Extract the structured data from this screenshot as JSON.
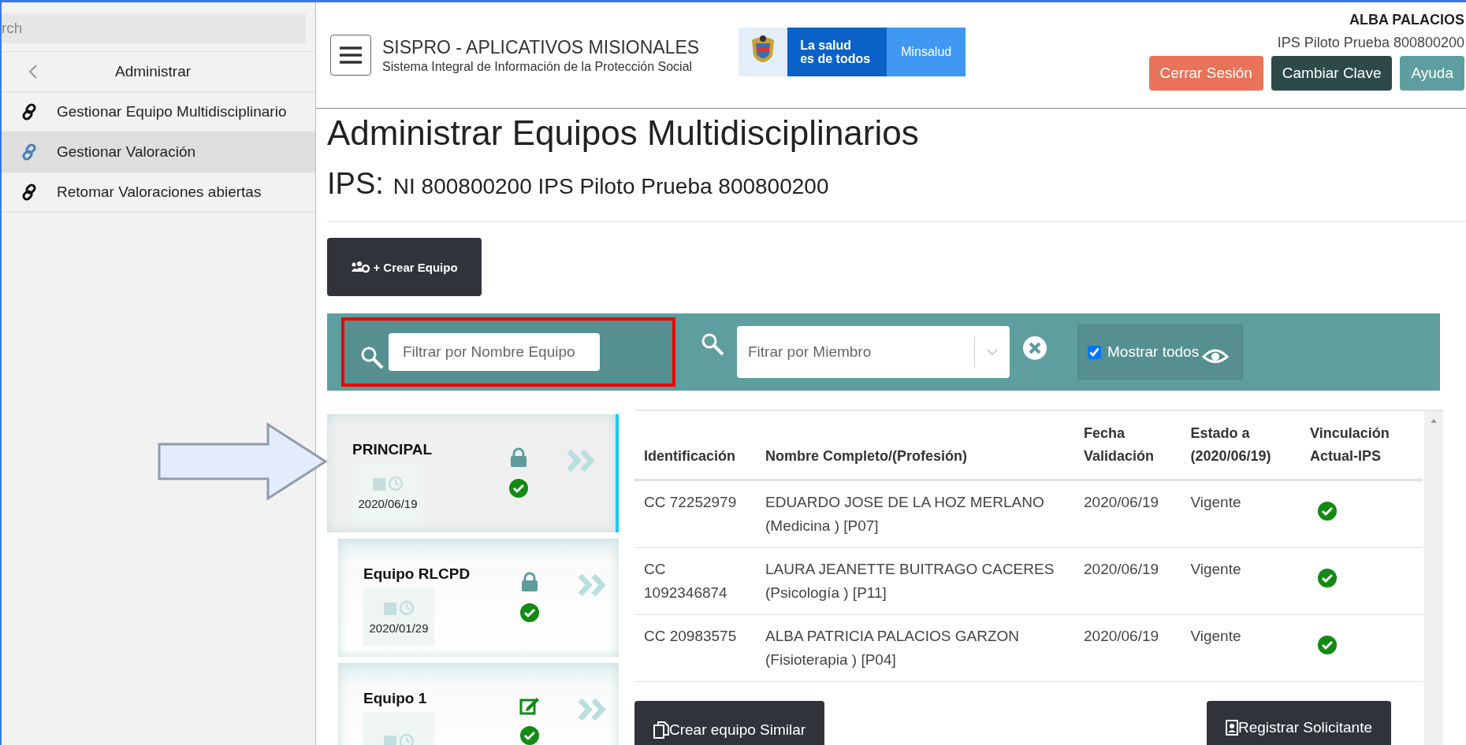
{
  "sidebar": {
    "search": {
      "value": "rch"
    },
    "back_label": "Administrar",
    "items": [
      {
        "label": "Gestionar Equipo Multidisciplinario",
        "selected": false
      },
      {
        "label": "Gestionar Valoración",
        "selected": true
      },
      {
        "label": "Retomar Valoraciones abiertas",
        "selected": false
      }
    ]
  },
  "header": {
    "app_title": "SISPRO - APLICATIVOS MISIONALES",
    "app_subtitle": "Sistema Integral de Información de la Protección Social",
    "logo": {
      "slogan_1": "La salud",
      "slogan_2": "es de todos",
      "brand": "Minsalud"
    },
    "user_name": "ALBA PALACIOS",
    "user_ips": "IPS Piloto Prueba 800800200",
    "buttons": [
      {
        "label": "Cerrar Sesión",
        "kind": "danger"
      },
      {
        "label": "Cambiar Clave",
        "kind": "dark"
      },
      {
        "label": "Ayuda",
        "kind": "info"
      }
    ]
  },
  "page": {
    "title": "Administrar Equipos Multidisciplinarios",
    "ips_label": "IPS:",
    "ips_value": "NI 800800200 IPS Piloto Prueba 800800200"
  },
  "create_button": {
    "label": "+ Crear Equipo"
  },
  "filters": {
    "team_placeholder": "Filtrar por Nombre Equipo",
    "member_placeholder": "Fitrar por Miembro",
    "show_all": {
      "label": "Mostrar todos",
      "checked": true
    }
  },
  "teams": [
    {
      "name": "PRINCIPAL",
      "date": "2020/06/19",
      "kind": "lock",
      "selected": true
    },
    {
      "name": "Equipo RLCPD",
      "date": "2020/01/29",
      "kind": "lock",
      "selected": false
    },
    {
      "name": "Equipo 1",
      "kind": "edit",
      "selected": false
    }
  ],
  "table": {
    "columns": [
      "Identificación",
      "Nombre Completo/(Profesión)",
      "Fecha Validación",
      "Estado a (2020/06/19)",
      "Vinculación Actual-IPS"
    ],
    "rows": [
      {
        "id": "CC 72252979",
        "name": "EDUARDO JOSE DE LA HOZ MERLANO (Medicina ) [P07]",
        "date": "2020/06/19",
        "status": "Vigente",
        "linked": true
      },
      {
        "id": "CC 1092346874",
        "name": "LAURA JEANETTE BUITRAGO CACERES (Psicología ) [P11]",
        "date": "2020/06/19",
        "status": "Vigente",
        "linked": true
      },
      {
        "id": "CC 20983575",
        "name": "ALBA PATRICIA PALACIOS GARZON (Fisioterapia ) [P04]",
        "date": "2020/06/19",
        "status": "Vigente",
        "linked": true
      }
    ]
  },
  "actions": [
    {
      "label": "Crear equipo Similar",
      "kind": "copy"
    },
    {
      "label": "Registrar Solicitante",
      "kind": "person"
    }
  ]
}
